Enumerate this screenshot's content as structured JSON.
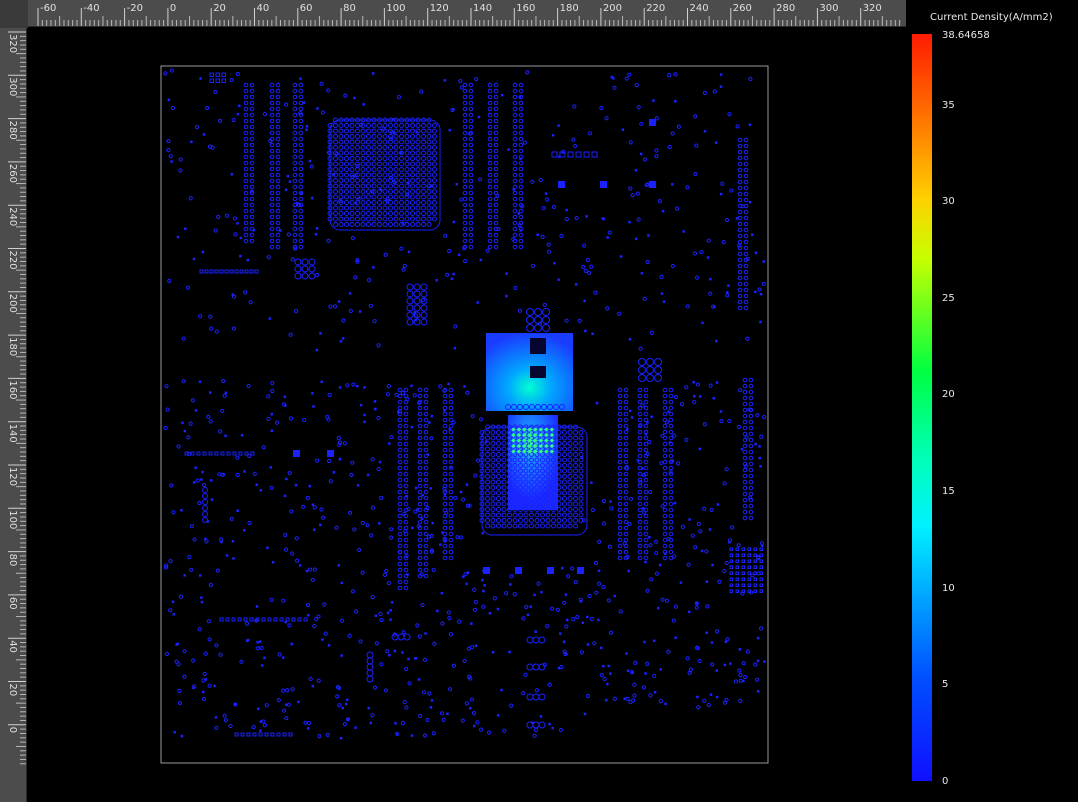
{
  "legend": {
    "title": "Current Density(A/mm2)",
    "max_label": "38.64658",
    "ticks": [
      "35",
      "30",
      "25",
      "20",
      "15",
      "10",
      "5",
      "0"
    ],
    "scale_min": 0,
    "scale_max": 38.64658,
    "colors": {
      "low": "#1010ff",
      "cyan": "#00f0ff",
      "green": "#00ff40",
      "yellow": "#ffd000",
      "high": "#ff1a00"
    }
  },
  "horizontal_ruler": {
    "labels": [
      "-60",
      "-40",
      "-20",
      "0",
      "20",
      "40",
      "60",
      "80",
      "100",
      "120",
      "140",
      "160",
      "180",
      "200",
      "220",
      "240",
      "260",
      "280",
      "300",
      "320"
    ]
  },
  "vertical_ruler": {
    "labels": [
      "320",
      "300",
      "280",
      "260",
      "240",
      "220",
      "200",
      "180",
      "160",
      "140",
      "120",
      "100",
      "80",
      "60",
      "40",
      "20",
      "0"
    ]
  },
  "board": {
    "outline_color": "#9a9a9a",
    "pad_color": "#1a22ff",
    "hotspot_color": "#2a7dff",
    "hotspot_peak_color": "#00ffd0"
  }
}
